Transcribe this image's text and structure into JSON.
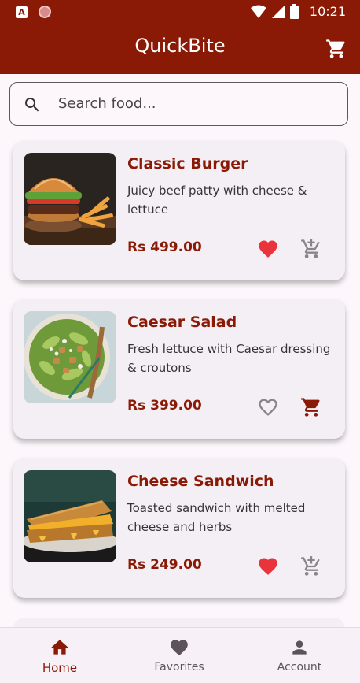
{
  "status_bar": {
    "time": "10:21",
    "app_badge": "A"
  },
  "app_bar": {
    "title": "QuickBite",
    "cart_icon": "shopping-cart-icon"
  },
  "search": {
    "placeholder": "Search food...",
    "icon": "search-icon"
  },
  "items": [
    {
      "name": "Classic Burger",
      "description": "Juicy beef patty with cheese & lettuce",
      "price": "Rs 499.00",
      "favorite": true,
      "in_cart": false
    },
    {
      "name": "Caesar Salad",
      "description": "Fresh lettuce with Caesar dressing & croutons",
      "price": "Rs 399.00",
      "favorite": false,
      "in_cart": true
    },
    {
      "name": "Cheese Sandwich",
      "description": "Toasted sandwich with melted cheese and herbs",
      "price": "Rs 249.00",
      "favorite": true,
      "in_cart": false
    }
  ],
  "bottom_nav": [
    {
      "label": "Home",
      "icon": "home-icon",
      "active": true
    },
    {
      "label": "Favorites",
      "icon": "heart-icon",
      "active": false
    },
    {
      "label": "Account",
      "icon": "person-icon",
      "active": false
    }
  ],
  "colors": {
    "primary": "#8a1a05",
    "heart": "#e8343a",
    "background": "#fdf7fc",
    "card": "#f4eff4"
  }
}
